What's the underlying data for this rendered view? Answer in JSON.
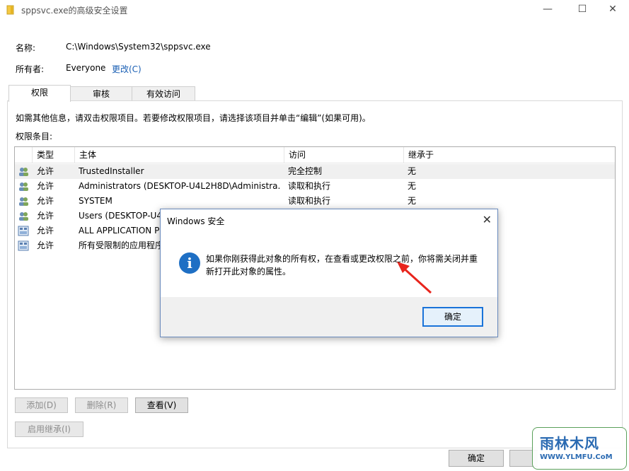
{
  "window": {
    "title": "sppsvc.exe的高级安全设置",
    "minimize": "—",
    "maximize": "☐",
    "close": "✕"
  },
  "props": {
    "name_label": "名称:",
    "name_value": "C:\\Windows\\System32\\sppsvc.exe",
    "owner_label": "所有者:",
    "owner_value": "Everyone",
    "change_link": "更改(C)"
  },
  "tabs": [
    {
      "label": "权限"
    },
    {
      "label": "审核"
    },
    {
      "label": "有效访问"
    }
  ],
  "panel": {
    "info": "如需其他信息，请双击权限项目。若要修改权限项目，请选择该项目并单击“编辑”(如果可用)。",
    "entries_label": "权限条目:"
  },
  "list": {
    "headers": {
      "type": "类型",
      "principal": "主体",
      "access": "访问",
      "inherited": "继承于"
    },
    "rows": [
      {
        "type": "允许",
        "principal": "TrustedInstaller",
        "access": "完全控制",
        "inherited": "无"
      },
      {
        "type": "允许",
        "principal": "Administrators (DESKTOP-U4L2H8D\\Administra...",
        "access": "读取和执行",
        "inherited": "无"
      },
      {
        "type": "允许",
        "principal": "SYSTEM",
        "access": "读取和执行",
        "inherited": "无"
      },
      {
        "type": "允许",
        "principal": "Users (DESKTOP-U4",
        "access": "",
        "inherited": ""
      },
      {
        "type": "允许",
        "principal": "ALL APPLICATION P",
        "access": "",
        "inherited": ""
      },
      {
        "type": "允许",
        "principal": "所有受限制的应用程序",
        "access": "",
        "inherited": ""
      }
    ]
  },
  "buttons": {
    "add": "添加(D)",
    "remove": "删除(R)",
    "view": "查看(V)",
    "enable_inheritance": "启用继承(I)",
    "ok": "确定"
  },
  "dialog": {
    "title": "Windows 安全",
    "close": "✕",
    "message": "如果你刚获得此对象的所有权，在查看或更改权限之前，你将需关闭并重新打开此对象的属性。",
    "ok": "确定"
  },
  "watermark": {
    "main": "雨林木风",
    "sub": "WWW.YLMFU.CoM"
  }
}
